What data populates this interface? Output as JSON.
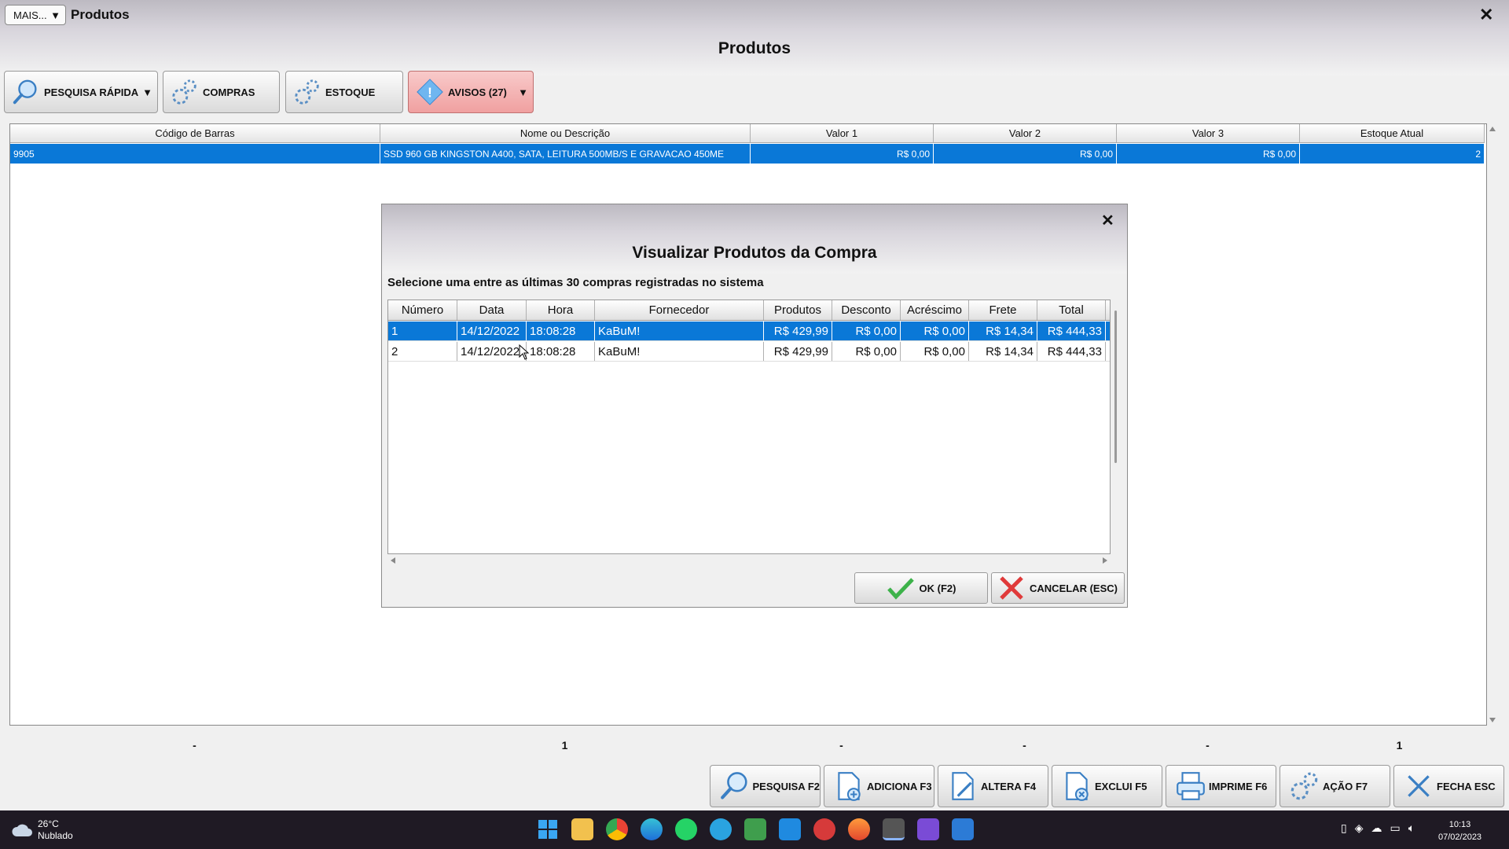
{
  "window": {
    "menu_label": "MAIS...",
    "menu_arrow": "▼",
    "title": "Produtos",
    "close": "✕",
    "page_title": "Produtos"
  },
  "toolbar": {
    "quick_search": "PESQUISA RÁPIDA",
    "purchases": "COMPRAS",
    "stock": "ESTOQUE",
    "alerts": "AVISOS (27)",
    "arrow": "▼"
  },
  "products": {
    "columns": [
      "Código de Barras",
      "Nome ou Descrição",
      "Valor 1",
      "Valor 2",
      "Valor 3",
      "Estoque Atual"
    ],
    "rows": [
      [
        "9905",
        "SSD 960 GB KINGSTON A400, SATA, LEITURA 500MB/S E GRAVACAO 450ME",
        "R$ 0,00",
        "R$ 0,00",
        "R$ 0,00",
        "2"
      ]
    ],
    "totals": [
      "-",
      "1",
      "-",
      "-",
      "-",
      "1"
    ]
  },
  "dialog": {
    "close": "✕",
    "title": "Visualizar Produtos da Compra",
    "subtitle": "Selecione uma entre as últimas 30 compras registradas no sistema",
    "columns": [
      "Número",
      "Data",
      "Hora",
      "Fornecedor",
      "Produtos",
      "Desconto",
      "Acréscimo",
      "Frete",
      "Total"
    ],
    "rows": [
      [
        "1",
        "14/12/2022",
        "18:08:28",
        "KaBuM!",
        "R$ 429,99",
        "R$ 0,00",
        "R$ 0,00",
        "R$ 14,34",
        "R$ 444,33"
      ],
      [
        "2",
        "14/12/2022",
        "18:08:28",
        "KaBuM!",
        "R$ 429,99",
        "R$ 0,00",
        "R$ 0,00",
        "R$ 14,34",
        "R$ 444,33"
      ]
    ],
    "ok": "OK (F2)",
    "cancel": "CANCELAR (ESC)"
  },
  "bottom": {
    "search": "PESQUISA F2",
    "add": "ADICIONA F3",
    "edit": "ALTERA F4",
    "delete": "EXCLUI F5",
    "print": "IMPRIME F6",
    "action": "AÇÃO F7",
    "close": "FECHA ESC"
  },
  "taskbar": {
    "temp": "26°C",
    "weather": "Nublado",
    "time": "10:13",
    "date": "07/02/2023"
  },
  "colors": {
    "selection": "#0a78d7",
    "alerts_bg": "#f4b8b8",
    "taskbar": "#1f1a24"
  }
}
